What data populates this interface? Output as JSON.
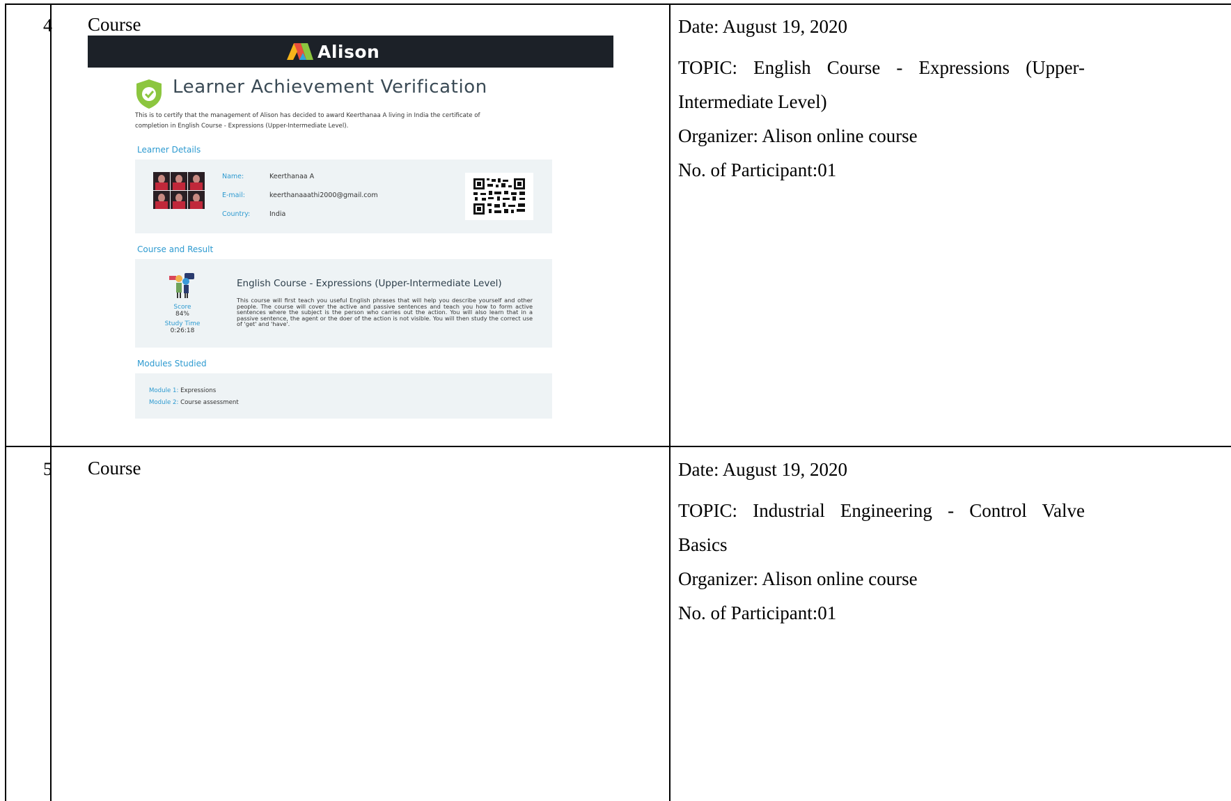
{
  "rows": [
    {
      "number": "4",
      "label": "Course",
      "details": {
        "date": "Date: August 19, 2020",
        "topic_line1": "TOPIC: English Course - Expressions (Upper-",
        "topic_line2": "Intermediate Level)",
        "organizer": "Organizer: Alison online course",
        "participants": "No. of Participant:01"
      }
    },
    {
      "number": "5",
      "label": "Course",
      "details": {
        "date": "Date: August 19, 2020",
        "topic_line1": "TOPIC: Industrial Engineering - Control Valve",
        "topic_line2": "Basics",
        "organizer": "Organizer: Alison online course",
        "participants": "No. of Participant:01"
      }
    }
  ],
  "certificate": {
    "brand": "Alison",
    "title": "Learner Achievement Verification",
    "intro_line1": "This is to certify that the management of Alison has decided to award Keerthanaa A living in India the certificate of",
    "intro_line2": "completion in English Course - Expressions (Upper-Intermediate Level).",
    "learner_details_heading": "Learner Details",
    "name_label": "Name:",
    "name_value": "Keerthanaa A",
    "email_label": "E-mail:",
    "email_value": "keerthanaaathi2000@gmail.com",
    "country_label": "Country:",
    "country_value": "India",
    "course_result_heading": "Course and Result",
    "course_name": "English Course - Expressions (Upper-Intermediate Level)",
    "course_description": "This course will first teach you useful English phrases that will help you describe yourself and other people. The course will cover the active and passive sentences and teach you how to form active sentences where the subject is the person who carries out the action. You will also learn that in a passive sentence, the agent or the doer of the action is not visible. You will then study the correct use of 'get' and 'have'.",
    "score_label": "Score",
    "score_value": "84%",
    "study_time_label": "Study Time",
    "study_time_value": "0:26:18",
    "modules_heading": "Modules Studied",
    "modules": [
      {
        "key": "Module 1:",
        "value": "Expressions"
      },
      {
        "key": "Module 2:",
        "value": "Course assessment"
      }
    ],
    "colors": {
      "accent": "#2d9ad0",
      "header_bar": "#1c2128",
      "panel": "#eef3f5",
      "shield": "#8cc63f"
    }
  }
}
